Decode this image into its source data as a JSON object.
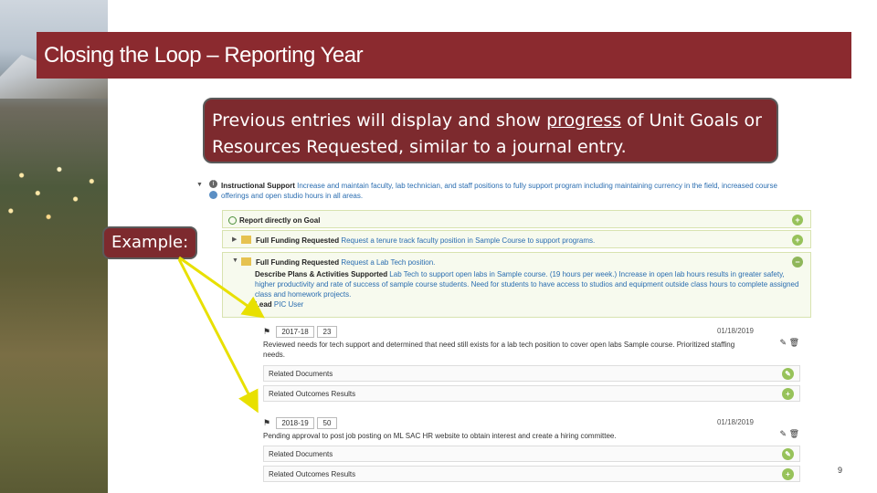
{
  "title": "Closing the Loop – Reporting Year",
  "callout": {
    "before": "Previous entries will display and show ",
    "underlined": "progress",
    "after": " of Unit Goals or Resources Requested, similar to a journal entry."
  },
  "example_label": "Example:",
  "page_number": "9",
  "screenshot": {
    "goal": {
      "bold": "Instructional Support",
      "text": " Increase and maintain faculty, lab technician, and staff positions to fully support program including maintaining currency in the field, increased course offerings and open studio hours in all areas."
    },
    "report_directly": "Report directly on Goal",
    "request1": {
      "bold": "Full Funding Requested",
      "text": " Request a tenure track faculty position in Sample Course to support programs."
    },
    "request2": {
      "bold": "Full Funding Requested",
      "text": " Request a Lab Tech position."
    },
    "describe": {
      "bold": "Describe Plans & Activities Supported",
      "text": " Lab Tech to support open labs in Sample course. (19 hours per week.) Increase in open lab hours results in greater safety, higher productivity and rate of success of sample course students. Need for students to have access to studios and equipment outside class hours to complete assigned class and homework projects."
    },
    "lead": {
      "bold": "Lead",
      "text": " PIC User"
    },
    "entries": [
      {
        "year": "2017-18",
        "num": "23",
        "date": "01/18/2019",
        "text": "Reviewed needs for tech support and determined that need still exists for a lab tech position to cover open labs Sample course. Prioritized staffing needs.",
        "docs": "Related Documents",
        "outcomes": "Related Outcomes Results"
      },
      {
        "year": "2018-19",
        "num": "50",
        "date": "01/18/2019",
        "text": "Pending approval to post job posting on ML SAC HR website to obtain interest and create a hiring committee.",
        "docs": "Related Documents",
        "outcomes": "Related Outcomes Results"
      }
    ]
  }
}
